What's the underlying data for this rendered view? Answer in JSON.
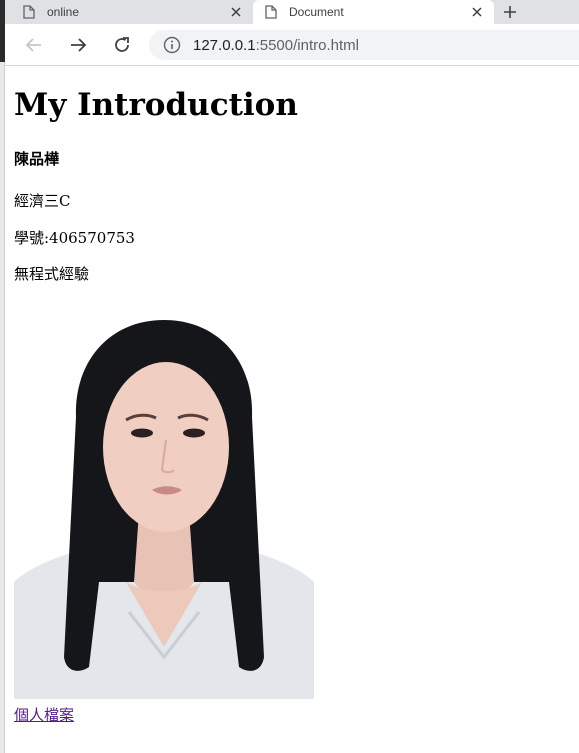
{
  "browser": {
    "tabs": [
      {
        "label": "online",
        "active": false
      },
      {
        "label": "Document",
        "active": true
      }
    ],
    "url": {
      "host": "127.0.0.1",
      "path": ":5500/intro.html"
    }
  },
  "page": {
    "heading": "My Introduction",
    "name": "陳品樺",
    "paragraphs": [
      "經濟三C",
      "學號:406570753",
      "無程式經驗"
    ],
    "photo_alt": "photo",
    "link": "個人檔案"
  },
  "colors": {
    "tabstrip_bg": "#dfe1e5",
    "omnibox_bg": "#f1f3f4",
    "visited_link": "#551a8b"
  }
}
